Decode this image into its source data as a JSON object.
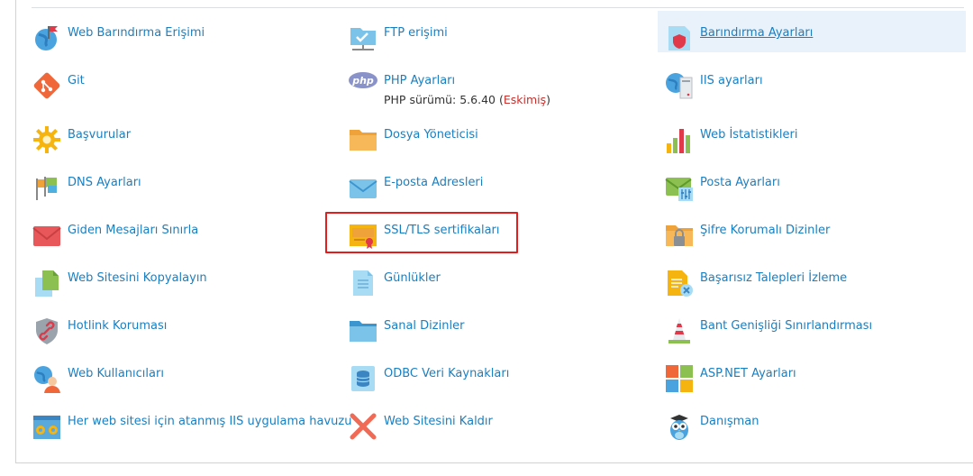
{
  "columns": [
    [
      {
        "label": "Web Barındırma Erişimi",
        "icon": "globe-flag-icon"
      },
      {
        "label": "Git",
        "icon": "git-icon"
      },
      {
        "label": "Başvurular",
        "icon": "gear-sun-icon"
      },
      {
        "label": "DNS Ayarları",
        "icon": "dns-flags-icon"
      },
      {
        "label": "Giden Mesajları Sınırla",
        "icon": "envelope-icon"
      },
      {
        "label": "Web Sitesini Kopyalayın",
        "icon": "copy-pages-icon"
      },
      {
        "label": "Hotlink Koruması",
        "icon": "shield-link-icon"
      },
      {
        "label": "Web Kullanıcıları",
        "icon": "globe-user-icon"
      },
      {
        "label": "Her web sitesi için atanmış IIS uygulama havuzu",
        "icon": "app-pool-icon"
      }
    ],
    [
      {
        "label": "FTP erişimi",
        "icon": "ftp-folder-icon"
      },
      {
        "label": "PHP Ayarları",
        "icon": "php-icon",
        "sub_prefix": "PHP sürümü: 5.6.40 (",
        "sub_status": "Eskimiş",
        "sub_suffix": ")"
      },
      {
        "label": "Dosya Yöneticisi",
        "icon": "folder-icon"
      },
      {
        "label": "E-posta Adresleri",
        "icon": "email-icon"
      },
      {
        "label": "SSL/TLS sertifikaları",
        "icon": "certificate-icon"
      },
      {
        "label": "Günlükler",
        "icon": "log-document-icon"
      },
      {
        "label": "Sanal Dizinler",
        "icon": "virtual-folder-icon"
      },
      {
        "label": "ODBC Veri Kaynakları",
        "icon": "database-icon"
      },
      {
        "label": "Web Sitesini Kaldır",
        "icon": "remove-x-icon"
      }
    ],
    [
      {
        "label": "Barındırma Ayarları",
        "icon": "hosting-settings-icon"
      },
      {
        "label": "IIS ayarları",
        "icon": "iis-settings-icon"
      },
      {
        "label": "Web İstatistikleri",
        "icon": "bar-chart-icon"
      },
      {
        "label": "Posta Ayarları",
        "icon": "mail-settings-icon"
      },
      {
        "label": "Şifre Korumalı Dizinler",
        "icon": "locked-folder-icon"
      },
      {
        "label": "Başarısız Talepleri İzleme",
        "icon": "failed-request-icon"
      },
      {
        "label": "Bant Genişliği Sınırlandırması",
        "icon": "bandwidth-cone-icon"
      },
      {
        "label": "ASP.NET Ayarları",
        "icon": "aspnet-icon"
      },
      {
        "label": "Danışman",
        "icon": "advisor-owl-icon"
      }
    ]
  ],
  "colors": {
    "link": "#1a7fc1",
    "outdated": "#c9302c",
    "highlight_box": "#e21d1d"
  }
}
